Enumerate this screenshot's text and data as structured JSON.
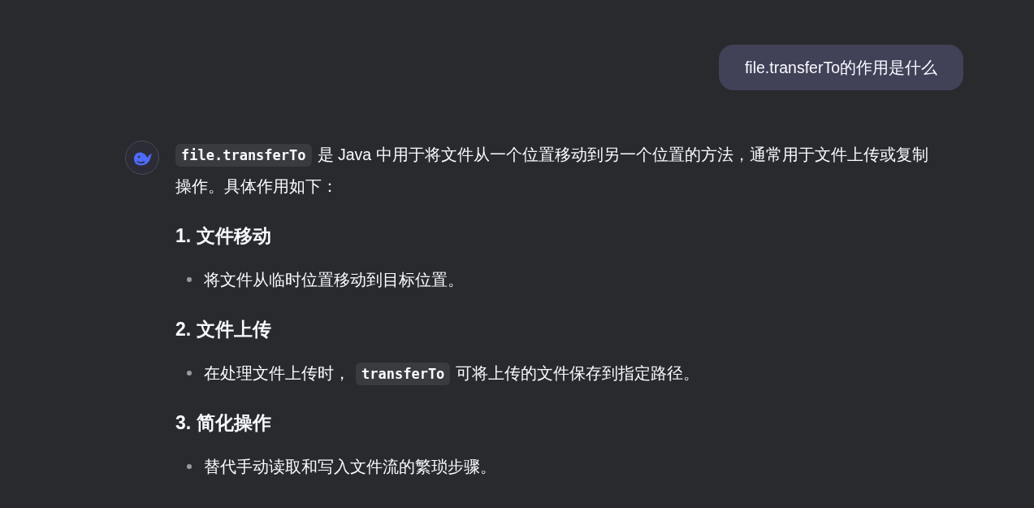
{
  "user_message": {
    "text": "file.transferTo的作用是什么"
  },
  "reply": {
    "intro": [
      {
        "kind": "code",
        "text": "file.transferTo"
      },
      {
        "kind": "text",
        "text": "是 Java 中用于将文件从一个位置移动到另一个位置的方法，通常用于文件上传或复制操作。具体作用如下："
      }
    ],
    "sections": [
      {
        "heading": "1. 文件移动",
        "bullets": [
          {
            "parts": [
              {
                "kind": "text",
                "text": "将文件从临时位置移动到目标位置。"
              }
            ]
          }
        ]
      },
      {
        "heading": "2. 文件上传",
        "bullets": [
          {
            "parts": [
              {
                "kind": "text",
                "text": "在处理文件上传时，"
              },
              {
                "kind": "code",
                "text": "transferTo"
              },
              {
                "kind": "text",
                "text": "可将上传的文件保存到指定路径。"
              }
            ]
          }
        ]
      },
      {
        "heading": "3. 简化操作",
        "bullets": [
          {
            "parts": [
              {
                "kind": "text",
                "text": "替代手动读取和写入文件流的繁琐步骤。"
              }
            ]
          }
        ]
      }
    ]
  }
}
